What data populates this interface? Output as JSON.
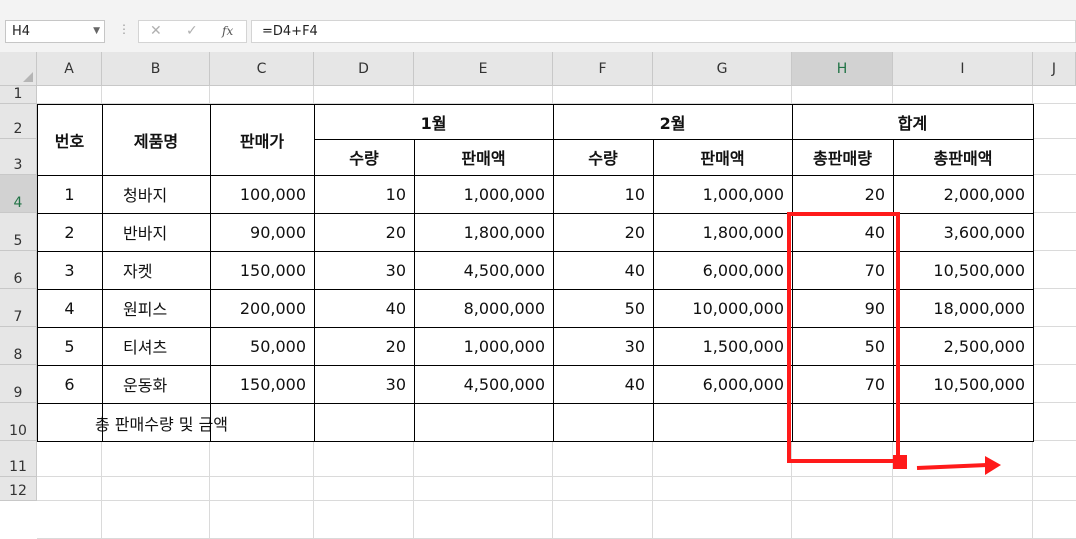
{
  "formula_bar": {
    "name_box": "H4",
    "cancel_icon": "✕",
    "enter_icon": "✓",
    "fx_label": "fx",
    "formula": "=D4+F4"
  },
  "columns": [
    "A",
    "B",
    "C",
    "D",
    "E",
    "F",
    "G",
    "H",
    "I",
    "J"
  ],
  "rows": [
    "1",
    "2",
    "3",
    "4",
    "5",
    "6",
    "7",
    "8",
    "9",
    "10",
    "11",
    "12"
  ],
  "headers": {
    "no": "번호",
    "product": "제품명",
    "price": "판매가",
    "jan": "1월",
    "feb": "2월",
    "total": "합계",
    "jan_qty": "수량",
    "jan_amt": "판매액",
    "feb_qty": "수량",
    "feb_amt": "판매액",
    "total_qty": "총판매량",
    "total_amt": "총판매액"
  },
  "table_rows": [
    {
      "no": "1",
      "product": "청바지",
      "price": "100,000",
      "jan_qty": "10",
      "jan_amt": "1,000,000",
      "feb_qty": "10",
      "feb_amt": "1,000,000",
      "total_qty": "20",
      "total_amt": "2,000,000"
    },
    {
      "no": "2",
      "product": "반바지",
      "price": "90,000",
      "jan_qty": "20",
      "jan_amt": "1,800,000",
      "feb_qty": "20",
      "feb_amt": "1,800,000",
      "total_qty": "40",
      "total_amt": "3,600,000"
    },
    {
      "no": "3",
      "product": "자켓",
      "price": "150,000",
      "jan_qty": "30",
      "jan_amt": "4,500,000",
      "feb_qty": "40",
      "feb_amt": "6,000,000",
      "total_qty": "70",
      "total_amt": "10,500,000"
    },
    {
      "no": "4",
      "product": "원피스",
      "price": "200,000",
      "jan_qty": "40",
      "jan_amt": "8,000,000",
      "feb_qty": "50",
      "feb_amt": "10,000,000",
      "total_qty": "90",
      "total_amt": "18,000,000"
    },
    {
      "no": "5",
      "product": "티셔츠",
      "price": "50,000",
      "jan_qty": "20",
      "jan_amt": "1,000,000",
      "feb_qty": "30",
      "feb_amt": "1,500,000",
      "total_qty": "50",
      "total_amt": "2,500,000"
    },
    {
      "no": "6",
      "product": "운동화",
      "price": "150,000",
      "jan_qty": "30",
      "jan_amt": "4,500,000",
      "feb_qty": "40",
      "feb_amt": "6,000,000",
      "total_qty": "70",
      "total_amt": "10,500,000"
    }
  ],
  "footer_label": "총 판매수량 및 금액",
  "annotation_color": "#ff1a1a"
}
